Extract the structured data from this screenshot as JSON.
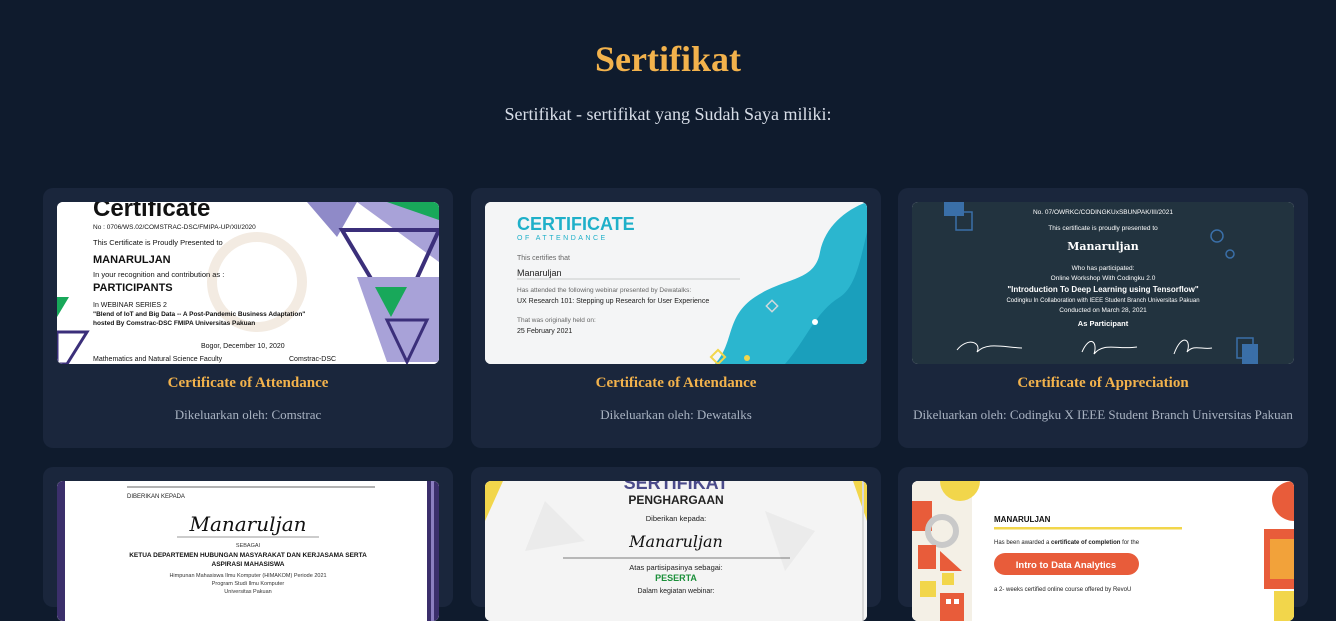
{
  "section": {
    "title": "Sertifikat",
    "subtitle": "Sertifikat - sertifikat yang Sudah Saya miliki:"
  },
  "certificates": [
    {
      "title": "Certificate of Attendance",
      "issuer": "Dikeluarkan oleh: Comstrac",
      "image_text": {
        "heading": "Certificate",
        "number": "No : 0706/WS.02/COMSTRAC-DSC/FMIPA-UP/XII/2020",
        "presented": "This Certificate is Proudly Presented to",
        "name": "MANARULJAN",
        "recognition": "In your recognition and contribution as :",
        "role": "PARTICIPANTS",
        "event": "In WEBINAR SERIES 2",
        "topic": "\"Blend of IoT and Big Data -- A Post-Pandemic Business Adaptation\"",
        "host": "hosted By Comstrac-DSC FMIPA Universitas Pakuan",
        "date": "Bogor, December 10, 2020",
        "faculty": "Mathematics and Natural Science Faculty",
        "org": "Comstrac-DSC"
      }
    },
    {
      "title": "Certificate of Attendance",
      "issuer": "Dikeluarkan oleh: Dewatalks",
      "image_text": {
        "heading": "CERTIFICATE",
        "subheading": "OF ATTENDANCE",
        "certifies": "This certifies that",
        "name": "Manaruljan",
        "attended": "Has attended the following webinar presented by Dewatalks:",
        "webinar": "UX Research 101: Stepping up Research for User Experience",
        "held": "That was originally held on:",
        "date": "25 February 2021"
      }
    },
    {
      "title": "Certificate of Appreciation",
      "issuer": "Dikeluarkan oleh: Codingku X IEEE Student Branch Universitas Pakuan",
      "image_text": {
        "number": "No. 07/OWRKC/CODINGKUxSBUNPAK/III/2021",
        "presented": "This certificate is proudly presented to",
        "name": "Manaruljan",
        "participated": "Who has participated:",
        "workshop": "Online Workshop With Codingku 2.0",
        "topic": "\"Introduction To Deep Learning using Tensorflow\"",
        "collab": "Codingku In Collaboration with IEEE Student Branch Universitas Pakuan",
        "conducted": "Conducted on March 28, 2021",
        "role": "As Participant"
      }
    },
    {
      "image_text": {
        "given": "DIBERIKAN KEPADA",
        "name": "Manaruljan",
        "as": "SEBAGAI",
        "role1": "KETUA DEPARTEMEN HUBUNGAN MASYARAKAT DAN KERJASAMA SERTA",
        "role2": "ASPIRASI MAHASISWA",
        "org1": "Himpunan Mahasiswa Ilmu Komputer (HIMAKOM) Periode 2021",
        "org2": "Program Studi Ilmu Komputer",
        "org3": "Universitas Pakuan"
      }
    },
    {
      "image_text": {
        "heading": "SERTIFIKAT",
        "subheading": "PENGHARGAAN",
        "given": "Diberikan kepada:",
        "name": "Manaruljan",
        "participation": "Atas partisipasinya sebagai:",
        "role": "PESERTA",
        "event": "Dalam kegiatan webinar:"
      }
    },
    {
      "image_text": {
        "name": "MANARULJAN",
        "awarded_pre": "Has been awarded a ",
        "awarded_bold": "certificate of completion",
        "awarded_post": " for the",
        "course": "Intro to Data Analytics",
        "desc": "a 2- weeks certified online course offered by RevoU"
      }
    }
  ]
}
